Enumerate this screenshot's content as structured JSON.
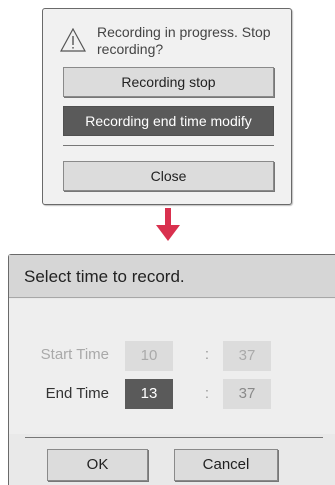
{
  "popup1": {
    "message": "Recording in progress. Stop recording?",
    "icon": "warning-icon",
    "buttons": {
      "stop": "Recording stop",
      "modify": "Recording end time modify",
      "close": "Close"
    }
  },
  "arrow": {
    "icon": "arrow-down-icon",
    "color": "#d9304e"
  },
  "popup2": {
    "title": "Select time to record.",
    "start": {
      "label": "Start Time",
      "hour": "10",
      "sep": ":",
      "minute": "37"
    },
    "end": {
      "label": "End Time",
      "hour": "13",
      "sep": ":",
      "minute": "37"
    },
    "buttons": {
      "ok": "OK",
      "cancel": "Cancel"
    }
  }
}
